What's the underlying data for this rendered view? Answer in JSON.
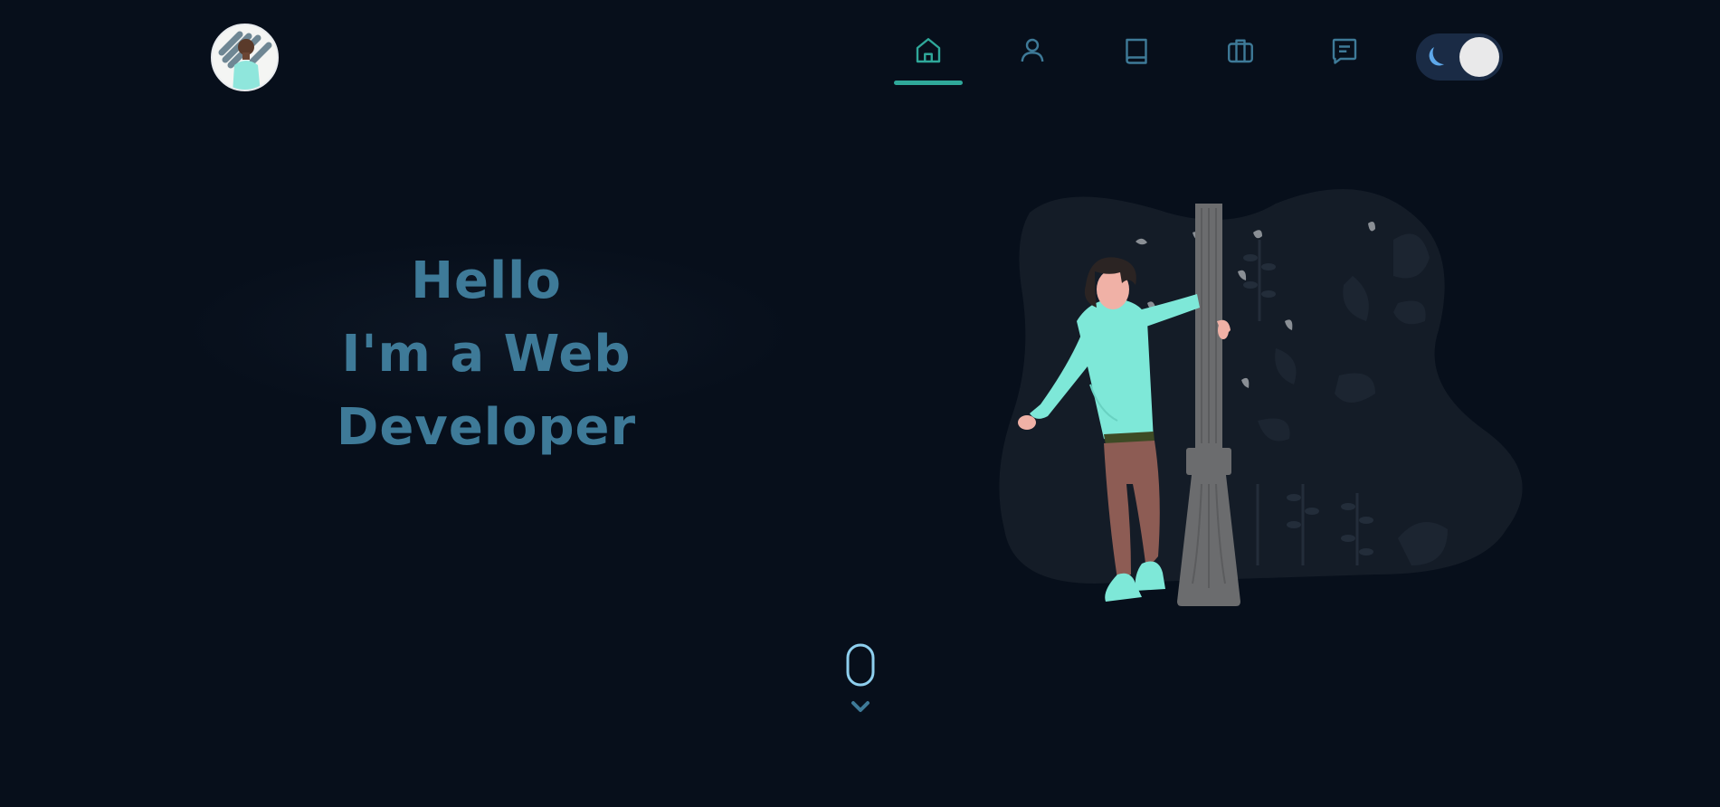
{
  "header": {
    "avatar_icon": "profile-photo",
    "nav": [
      {
        "id": "home",
        "icon": "home-icon",
        "active": true
      },
      {
        "id": "about",
        "icon": "user-icon",
        "active": false
      },
      {
        "id": "skills",
        "icon": "book-icon",
        "active": false
      },
      {
        "id": "portfolio",
        "icon": "briefcase-icon",
        "active": false
      },
      {
        "id": "contact",
        "icon": "message-icon",
        "active": false
      }
    ],
    "theme_toggle": {
      "icon": "moon-icon",
      "state": "dark"
    }
  },
  "hero": {
    "line1": "Hello",
    "line2": "I'm a Web Developer"
  },
  "scroll_indicator": {
    "icons": [
      "mouse-icon",
      "chevron-down-icon"
    ]
  },
  "colors": {
    "background": "#070f1b",
    "heading": "#3e7a98",
    "active_nav": "#2fa89a",
    "nav_icon": "#3e7a98",
    "accent_mint": "#7ee8d8"
  }
}
